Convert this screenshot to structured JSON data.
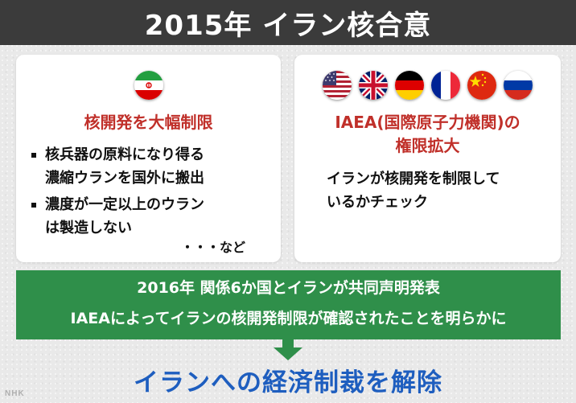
{
  "title": "2015年 イラン核合意",
  "left_card": {
    "flag_icons": [
      "iran-flag-icon"
    ],
    "heading": "核開発を大幅制限",
    "bullets": [
      {
        "line1": "核兵器の原料になり得る",
        "line2": "濃縮ウランを国外に搬出"
      },
      {
        "line1": "濃度が一定以上のウラン",
        "line2": "は製造しない"
      }
    ],
    "etc": "・・・など"
  },
  "right_card": {
    "flag_icons": [
      "usa-flag-icon",
      "uk-flag-icon",
      "germany-flag-icon",
      "france-flag-icon",
      "china-flag-icon",
      "russia-flag-icon"
    ],
    "heading_line1": "IAEA(国際原子力機関)の",
    "heading_line2": "権限拡大",
    "body_line1": "イランが核開発を制限して",
    "body_line2": "いるかチェック"
  },
  "green_box": {
    "line1": "2016年 関係6か国とイランが共同声明発表",
    "line2": "IAEAによってイランの核開発制限が確認されたことを明らかに"
  },
  "result": "イランへの経済制裁を解除",
  "watermark": "NHK",
  "colors": {
    "title_bar": "#3b3b3b",
    "heading_red": "#c0302a",
    "green_box": "#2f8f4a",
    "result_blue": "#1e5ebf"
  }
}
